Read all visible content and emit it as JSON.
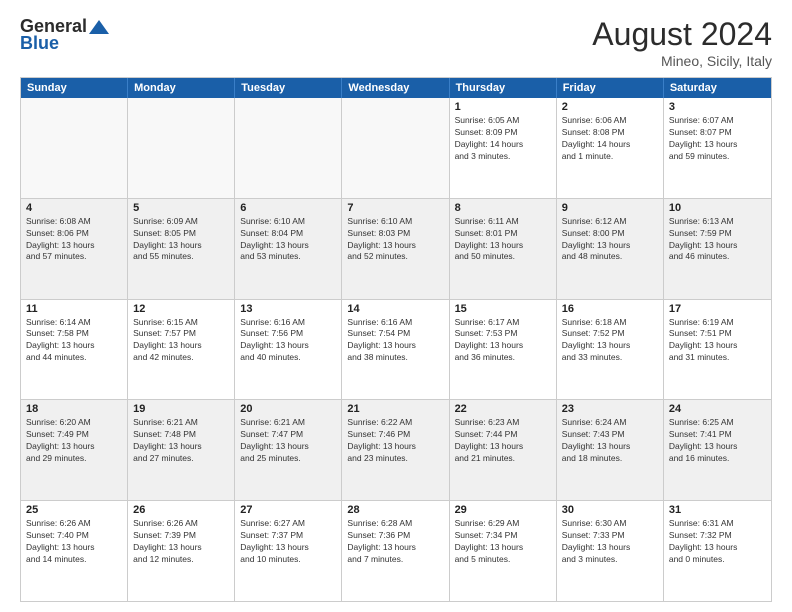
{
  "logo": {
    "line1": "General",
    "line2": "Blue"
  },
  "title": "August 2024",
  "subtitle": "Mineo, Sicily, Italy",
  "days": [
    "Sunday",
    "Monday",
    "Tuesday",
    "Wednesday",
    "Thursday",
    "Friday",
    "Saturday"
  ],
  "rows": [
    [
      {
        "day": "",
        "empty": true
      },
      {
        "day": "",
        "empty": true
      },
      {
        "day": "",
        "empty": true
      },
      {
        "day": "",
        "empty": true
      },
      {
        "day": "1",
        "line1": "Sunrise: 6:05 AM",
        "line2": "Sunset: 8:09 PM",
        "line3": "Daylight: 14 hours",
        "line4": "and 3 minutes."
      },
      {
        "day": "2",
        "line1": "Sunrise: 6:06 AM",
        "line2": "Sunset: 8:08 PM",
        "line3": "Daylight: 14 hours",
        "line4": "and 1 minute."
      },
      {
        "day": "3",
        "line1": "Sunrise: 6:07 AM",
        "line2": "Sunset: 8:07 PM",
        "line3": "Daylight: 13 hours",
        "line4": "and 59 minutes."
      }
    ],
    [
      {
        "day": "4",
        "line1": "Sunrise: 6:08 AM",
        "line2": "Sunset: 8:06 PM",
        "line3": "Daylight: 13 hours",
        "line4": "and 57 minutes."
      },
      {
        "day": "5",
        "line1": "Sunrise: 6:09 AM",
        "line2": "Sunset: 8:05 PM",
        "line3": "Daylight: 13 hours",
        "line4": "and 55 minutes."
      },
      {
        "day": "6",
        "line1": "Sunrise: 6:10 AM",
        "line2": "Sunset: 8:04 PM",
        "line3": "Daylight: 13 hours",
        "line4": "and 53 minutes."
      },
      {
        "day": "7",
        "line1": "Sunrise: 6:10 AM",
        "line2": "Sunset: 8:03 PM",
        "line3": "Daylight: 13 hours",
        "line4": "and 52 minutes."
      },
      {
        "day": "8",
        "line1": "Sunrise: 6:11 AM",
        "line2": "Sunset: 8:01 PM",
        "line3": "Daylight: 13 hours",
        "line4": "and 50 minutes."
      },
      {
        "day": "9",
        "line1": "Sunrise: 6:12 AM",
        "line2": "Sunset: 8:00 PM",
        "line3": "Daylight: 13 hours",
        "line4": "and 48 minutes."
      },
      {
        "day": "10",
        "line1": "Sunrise: 6:13 AM",
        "line2": "Sunset: 7:59 PM",
        "line3": "Daylight: 13 hours",
        "line4": "and 46 minutes."
      }
    ],
    [
      {
        "day": "11",
        "line1": "Sunrise: 6:14 AM",
        "line2": "Sunset: 7:58 PM",
        "line3": "Daylight: 13 hours",
        "line4": "and 44 minutes."
      },
      {
        "day": "12",
        "line1": "Sunrise: 6:15 AM",
        "line2": "Sunset: 7:57 PM",
        "line3": "Daylight: 13 hours",
        "line4": "and 42 minutes."
      },
      {
        "day": "13",
        "line1": "Sunrise: 6:16 AM",
        "line2": "Sunset: 7:56 PM",
        "line3": "Daylight: 13 hours",
        "line4": "and 40 minutes."
      },
      {
        "day": "14",
        "line1": "Sunrise: 6:16 AM",
        "line2": "Sunset: 7:54 PM",
        "line3": "Daylight: 13 hours",
        "line4": "and 38 minutes."
      },
      {
        "day": "15",
        "line1": "Sunrise: 6:17 AM",
        "line2": "Sunset: 7:53 PM",
        "line3": "Daylight: 13 hours",
        "line4": "and 36 minutes."
      },
      {
        "day": "16",
        "line1": "Sunrise: 6:18 AM",
        "line2": "Sunset: 7:52 PM",
        "line3": "Daylight: 13 hours",
        "line4": "and 33 minutes."
      },
      {
        "day": "17",
        "line1": "Sunrise: 6:19 AM",
        "line2": "Sunset: 7:51 PM",
        "line3": "Daylight: 13 hours",
        "line4": "and 31 minutes."
      }
    ],
    [
      {
        "day": "18",
        "line1": "Sunrise: 6:20 AM",
        "line2": "Sunset: 7:49 PM",
        "line3": "Daylight: 13 hours",
        "line4": "and 29 minutes."
      },
      {
        "day": "19",
        "line1": "Sunrise: 6:21 AM",
        "line2": "Sunset: 7:48 PM",
        "line3": "Daylight: 13 hours",
        "line4": "and 27 minutes."
      },
      {
        "day": "20",
        "line1": "Sunrise: 6:21 AM",
        "line2": "Sunset: 7:47 PM",
        "line3": "Daylight: 13 hours",
        "line4": "and 25 minutes."
      },
      {
        "day": "21",
        "line1": "Sunrise: 6:22 AM",
        "line2": "Sunset: 7:46 PM",
        "line3": "Daylight: 13 hours",
        "line4": "and 23 minutes."
      },
      {
        "day": "22",
        "line1": "Sunrise: 6:23 AM",
        "line2": "Sunset: 7:44 PM",
        "line3": "Daylight: 13 hours",
        "line4": "and 21 minutes."
      },
      {
        "day": "23",
        "line1": "Sunrise: 6:24 AM",
        "line2": "Sunset: 7:43 PM",
        "line3": "Daylight: 13 hours",
        "line4": "and 18 minutes."
      },
      {
        "day": "24",
        "line1": "Sunrise: 6:25 AM",
        "line2": "Sunset: 7:41 PM",
        "line3": "Daylight: 13 hours",
        "line4": "and 16 minutes."
      }
    ],
    [
      {
        "day": "25",
        "line1": "Sunrise: 6:26 AM",
        "line2": "Sunset: 7:40 PM",
        "line3": "Daylight: 13 hours",
        "line4": "and 14 minutes."
      },
      {
        "day": "26",
        "line1": "Sunrise: 6:26 AM",
        "line2": "Sunset: 7:39 PM",
        "line3": "Daylight: 13 hours",
        "line4": "and 12 minutes."
      },
      {
        "day": "27",
        "line1": "Sunrise: 6:27 AM",
        "line2": "Sunset: 7:37 PM",
        "line3": "Daylight: 13 hours",
        "line4": "and 10 minutes."
      },
      {
        "day": "28",
        "line1": "Sunrise: 6:28 AM",
        "line2": "Sunset: 7:36 PM",
        "line3": "Daylight: 13 hours",
        "line4": "and 7 minutes."
      },
      {
        "day": "29",
        "line1": "Sunrise: 6:29 AM",
        "line2": "Sunset: 7:34 PM",
        "line3": "Daylight: 13 hours",
        "line4": "and 5 minutes."
      },
      {
        "day": "30",
        "line1": "Sunrise: 6:30 AM",
        "line2": "Sunset: 7:33 PM",
        "line3": "Daylight: 13 hours",
        "line4": "and 3 minutes."
      },
      {
        "day": "31",
        "line1": "Sunrise: 6:31 AM",
        "line2": "Sunset: 7:32 PM",
        "line3": "Daylight: 13 hours",
        "line4": "and 0 minutes."
      }
    ]
  ]
}
